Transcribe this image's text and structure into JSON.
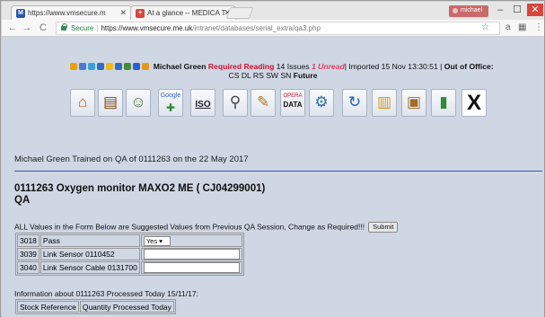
{
  "browser": {
    "tabs": [
      {
        "label": "https://www.vmsecure.m",
        "favicon": "vm-icon"
      },
      {
        "label": "At a glance -- MEDICA T",
        "favicon": "medica-icon"
      }
    ],
    "profile": "michael",
    "secure_label": "Secure",
    "url_host": "https://www.vmsecure.me.uk",
    "url_path": "/intranet/databases/serial_extra/qa3.php"
  },
  "status": {
    "user": "Michael Green",
    "required_reading": "Required Reading",
    "issues": "14 Issues",
    "unread": "1 Unread",
    "imported": "| Imported 15 Nov 13:30:51 |",
    "out_of_office": "Out of Office:",
    "codes": "CS DL RS SW SN",
    "future": "Future"
  },
  "toolbar_icons": [
    {
      "name": "home-icon",
      "glyph": "⌂",
      "color": "#c25a1a"
    },
    {
      "name": "drawer-icon",
      "glyph": "▤",
      "color": "#7a4a1c"
    },
    {
      "name": "people-icon",
      "glyph": "👥",
      "color": "#4a6b3a"
    },
    {
      "name": "google-icon",
      "glyph": "G",
      "color": "#2b5fd6",
      "label": "Google"
    },
    {
      "name": "iso-icon",
      "glyph": "ISO",
      "color": "#222"
    },
    {
      "name": "magnifier-icon",
      "glyph": "⚲",
      "color": "#444"
    },
    {
      "name": "pen-icon",
      "glyph": "✎",
      "color": "#b07a1a"
    },
    {
      "name": "opera-data-icon",
      "glyph": "DATA",
      "color": "#c8102e",
      "label": "OPERA"
    },
    {
      "name": "settings-icon",
      "glyph": "⚙",
      "color": "#2f6fa8"
    },
    {
      "name": "refresh-icon",
      "glyph": "↻",
      "color": "#1c5fb0"
    },
    {
      "name": "folder-chart-icon",
      "glyph": "▥",
      "color": "#d49a1c"
    },
    {
      "name": "box-icon",
      "glyph": "▣",
      "color": "#a06c2a"
    },
    {
      "name": "book-icon",
      "glyph": "▮",
      "color": "#2f8a3a"
    },
    {
      "name": "close-x-icon",
      "glyph": "X",
      "color": "#111"
    }
  ],
  "trained_text": "Michael Green Trained on QA of 0111263 on the 22 May 2017",
  "device_title": "0111263 Oxygen monitor MAXO2 ME ( CJ04299001)",
  "qa_heading": "QA",
  "note": "ALL Values in the Form Below are Suggested Values from Previous QA Session, Change as Required!!!",
  "submit_label": "Submit",
  "qa_rows": [
    {
      "id": "3018",
      "label": "Pass",
      "type": "select",
      "value": "Yes"
    },
    {
      "id": "3039",
      "label": "Link Sensor 0110452",
      "type": "input",
      "value": ""
    },
    {
      "id": "3040",
      "label": "Link Sensor Cable 0131700",
      "type": "input",
      "value": ""
    }
  ],
  "processed_info": "Information about 0111263 Processed Today 15/11/17:",
  "stock_headers": [
    "Stock Reference",
    "Quantity Processed Today"
  ]
}
